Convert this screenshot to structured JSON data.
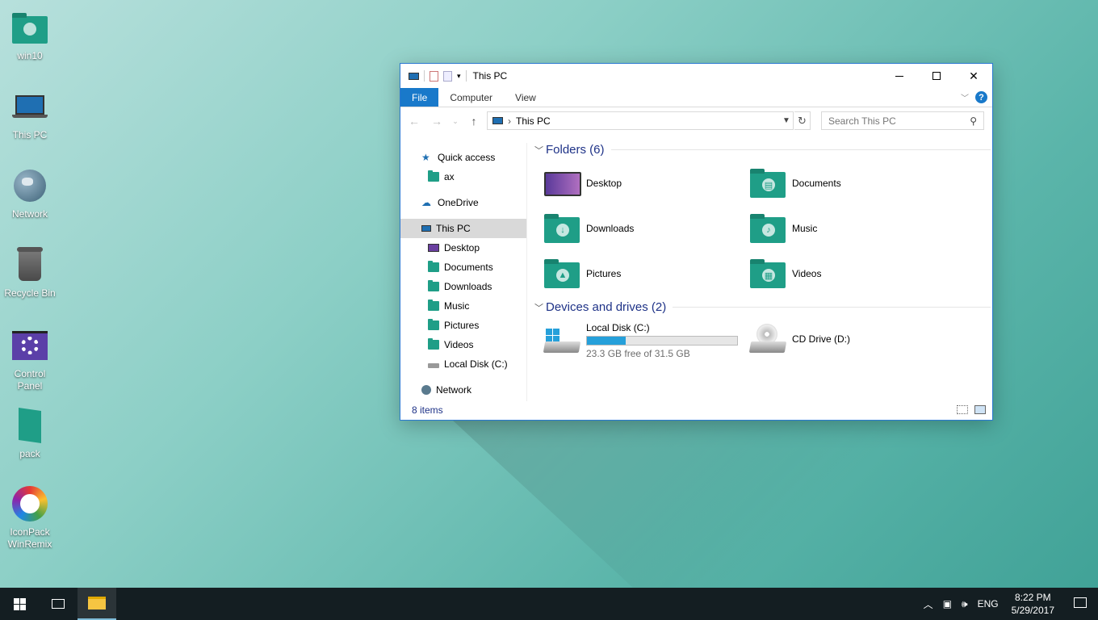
{
  "desktop": {
    "icons": [
      {
        "label": "win10",
        "icon": "user-folder-icon"
      },
      {
        "label": "This PC",
        "icon": "laptop-icon"
      },
      {
        "label": "Network",
        "icon": "globe-icon"
      },
      {
        "label": "Recycle Bin",
        "icon": "recycle-bin-icon"
      },
      {
        "label": "Control Panel",
        "icon": "control-panel-icon"
      },
      {
        "label": "pack",
        "icon": "folder-icon"
      },
      {
        "label": "IconPack WinRemix",
        "icon": "iconpack-icon"
      }
    ]
  },
  "window": {
    "title": "This PC",
    "tabs": {
      "file": "File",
      "computer": "Computer",
      "view": "View"
    },
    "help": "?",
    "address": {
      "location": "This PC"
    },
    "search": {
      "placeholder": "Search This PC"
    },
    "nav": {
      "quick_access": "Quick access",
      "ax": "ax",
      "onedrive": "OneDrive",
      "this_pc": "This PC",
      "desktop": "Desktop",
      "documents": "Documents",
      "downloads": "Downloads",
      "music": "Music",
      "pictures": "Pictures",
      "videos": "Videos",
      "local_disk": "Local Disk (C:)",
      "network": "Network"
    },
    "folders_header": "Folders (6)",
    "folders": {
      "desktop": "Desktop",
      "documents": "Documents",
      "downloads": "Downloads",
      "music": "Music",
      "pictures": "Pictures",
      "videos": "Videos"
    },
    "devices_header": "Devices and drives (2)",
    "drives": {
      "c_name": "Local Disk (C:)",
      "c_free": "23.3 GB free of 31.5 GB",
      "c_used_fraction": 0.26,
      "d_name": "CD Drive (D:)"
    },
    "status": "8 items"
  },
  "taskbar": {
    "language": "ENG",
    "time": "8:22 PM",
    "date": "5/29/2017"
  },
  "colors": {
    "accent": "#1979ca",
    "folder": "#1f9e87",
    "taskbar": "#141e22",
    "progress": "#26a0da"
  }
}
